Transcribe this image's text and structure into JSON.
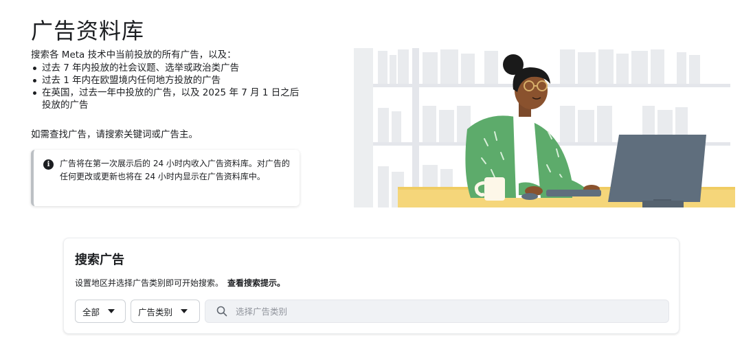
{
  "header": {
    "title": "广告资料库"
  },
  "intro": {
    "lead": "搜索各 Meta 技术中当前投放的所有广告，以及：",
    "bullets": [
      "过去 7 年内投放的社会议题、选举或政治类广告",
      "过去 1 年内在欧盟境内任何地方投放的广告",
      "在英国，过去一年中投放的广告，以及 2025 年 7 月 1 日之后投放的广告"
    ],
    "find": "如需查找广告，请搜索关键词或广告主。"
  },
  "notice": {
    "icon": "info-icon",
    "text": "广告将在第一次展示后的 24 小时内收入广告资料库。对广告的任何更改或更新也将在 24 小时内显示在广告资料库中。"
  },
  "search": {
    "title": "搜索广告",
    "hint": "设置地区并选择广告类别即可开始搜索。",
    "tips_link": "查看搜索提示。",
    "region_selected": "全部",
    "category_selected": "广告类别",
    "input_placeholder": "选择广告类别",
    "input_value": ""
  },
  "colors": {
    "text": "#1c1e21",
    "card_border": "#bcc0c4",
    "search_bg": "#f0f2f5",
    "desk": "#f5d67a",
    "sweater": "#5dab6b",
    "monitor": "#5f6e7d",
    "shelf": "#e4e6eb"
  }
}
